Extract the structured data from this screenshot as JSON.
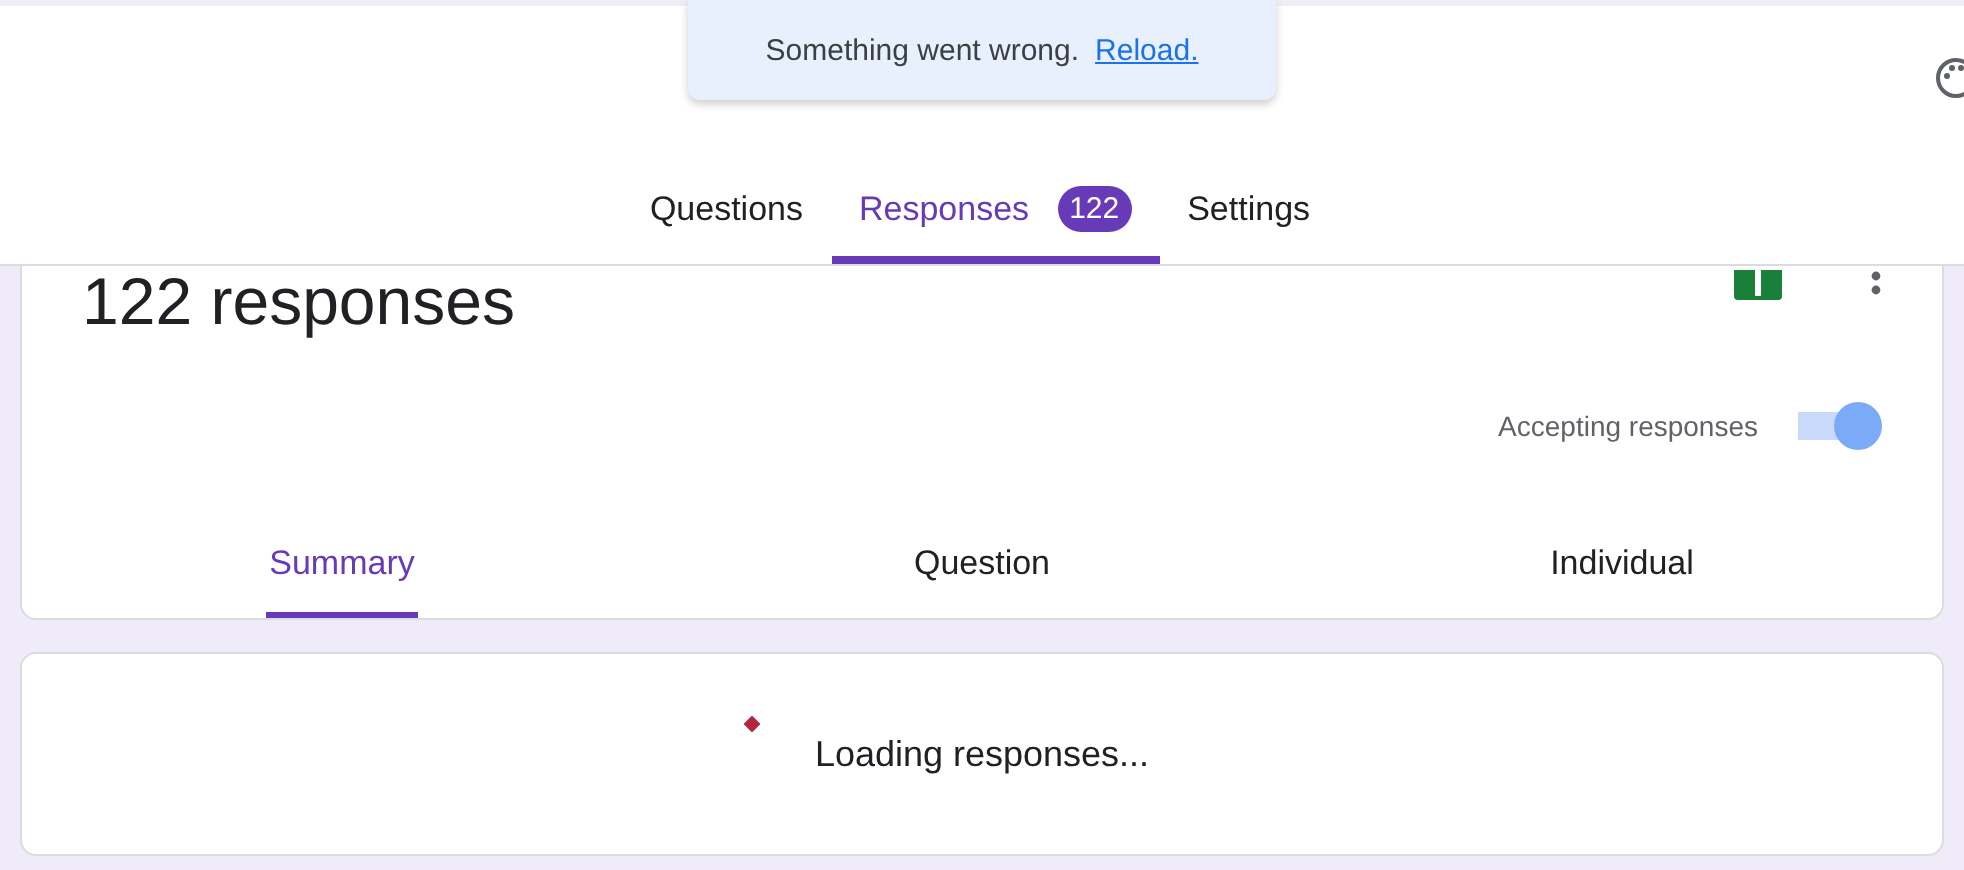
{
  "toast": {
    "message": "Something went wrong.",
    "link": "Reload."
  },
  "tabs": [
    {
      "label": "Questions",
      "selected": false
    },
    {
      "label": "Responses",
      "selected": true,
      "badge": "122"
    },
    {
      "label": "Settings",
      "selected": false
    }
  ],
  "summary": {
    "title": "122 responses",
    "accepting": {
      "label": "Accepting responses",
      "on": true
    }
  },
  "view_tabs": [
    {
      "label": "Summary",
      "selected": true
    },
    {
      "label": "Question",
      "selected": false
    },
    {
      "label": "Individual",
      "selected": false
    }
  ],
  "loading": {
    "message": "Loading responses..."
  }
}
